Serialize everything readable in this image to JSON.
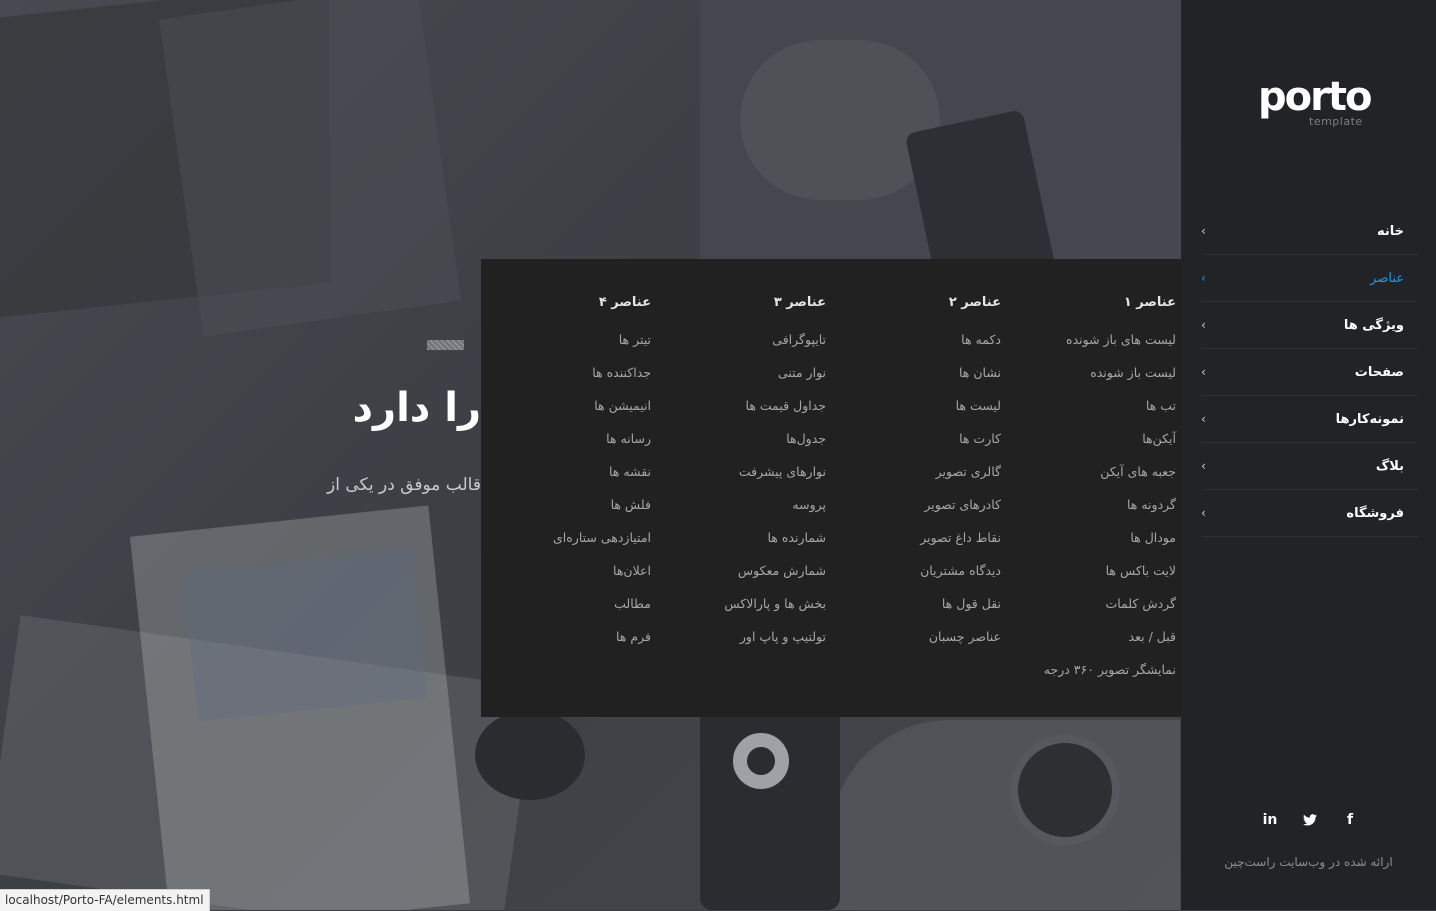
{
  "hero": {
    "title": "را دارد",
    "subtitle": "قالب موفق در یکی از"
  },
  "mega_menu": {
    "columns": [
      {
        "title": "عناصر ۱",
        "items": [
          "لیست های باز شونده",
          "لیست باز شونده",
          "تب ها",
          "آیکن‌ها",
          "جعبه های آیکن",
          "گردونه ها",
          "مودال ها",
          "لایت باکس ها",
          "گردش کلمات",
          "قبل / بعد",
          "نمایشگر تصویر ۳۶۰ درجه"
        ]
      },
      {
        "title": "عناصر ۲",
        "items": [
          "دکمه ها",
          "نشان ها",
          "لیست ها",
          "کارت ها",
          "گالری تصویر",
          "کادرهای تصویر",
          "نقاط داغ تصویر",
          "دیدگاه مشتریان",
          "نقل قول ها",
          "عناصر چسبان"
        ]
      },
      {
        "title": "عناصر ۳",
        "items": [
          "تایپوگرافی",
          "نوار متنی",
          "جداول قیمت ها",
          "جدول‌ها",
          "نوارهای پیشرفت",
          "پروسه",
          "شمارنده ها",
          "شمارش معکوس",
          "بخش ها و پارالاکس",
          "تولتیپ و پاپ اور"
        ]
      },
      {
        "title": "عناصر ۴",
        "items": [
          "تیتر ها",
          "جداکننده ها",
          "انیمیشن ها",
          "رسانه ها",
          "نقشه ها",
          "فلش ها",
          "امتیازدهی ستاره‌ای",
          "اعلان‌ها",
          "مطالب",
          "فرم ها"
        ]
      }
    ]
  },
  "sidebar": {
    "logo_word": "porto",
    "logo_sub": "template",
    "nav": [
      {
        "label": "خانه",
        "active": false
      },
      {
        "label": "عناصر",
        "active": true
      },
      {
        "label": "ویژگی ها",
        "active": false
      },
      {
        "label": "صفحات",
        "active": false
      },
      {
        "label": "نمونه‌کارها",
        "active": false
      },
      {
        "label": "بلاگ",
        "active": false
      },
      {
        "label": "فروشگاه",
        "active": false
      }
    ],
    "social": [
      {
        "icon": "linkedin-icon",
        "glyph": "in"
      },
      {
        "icon": "twitter-icon",
        "glyph": "🐦"
      },
      {
        "icon": "facebook-icon",
        "glyph": "f"
      }
    ],
    "credit": "ارائه شده در وب‌سایت راست‌چین"
  },
  "status_bar": {
    "url": "localhost/Porto-FA/elements.html"
  },
  "colors": {
    "accent": "#1a9be6",
    "sidebar_bg": "#212326",
    "menu_bg": "#212121"
  }
}
